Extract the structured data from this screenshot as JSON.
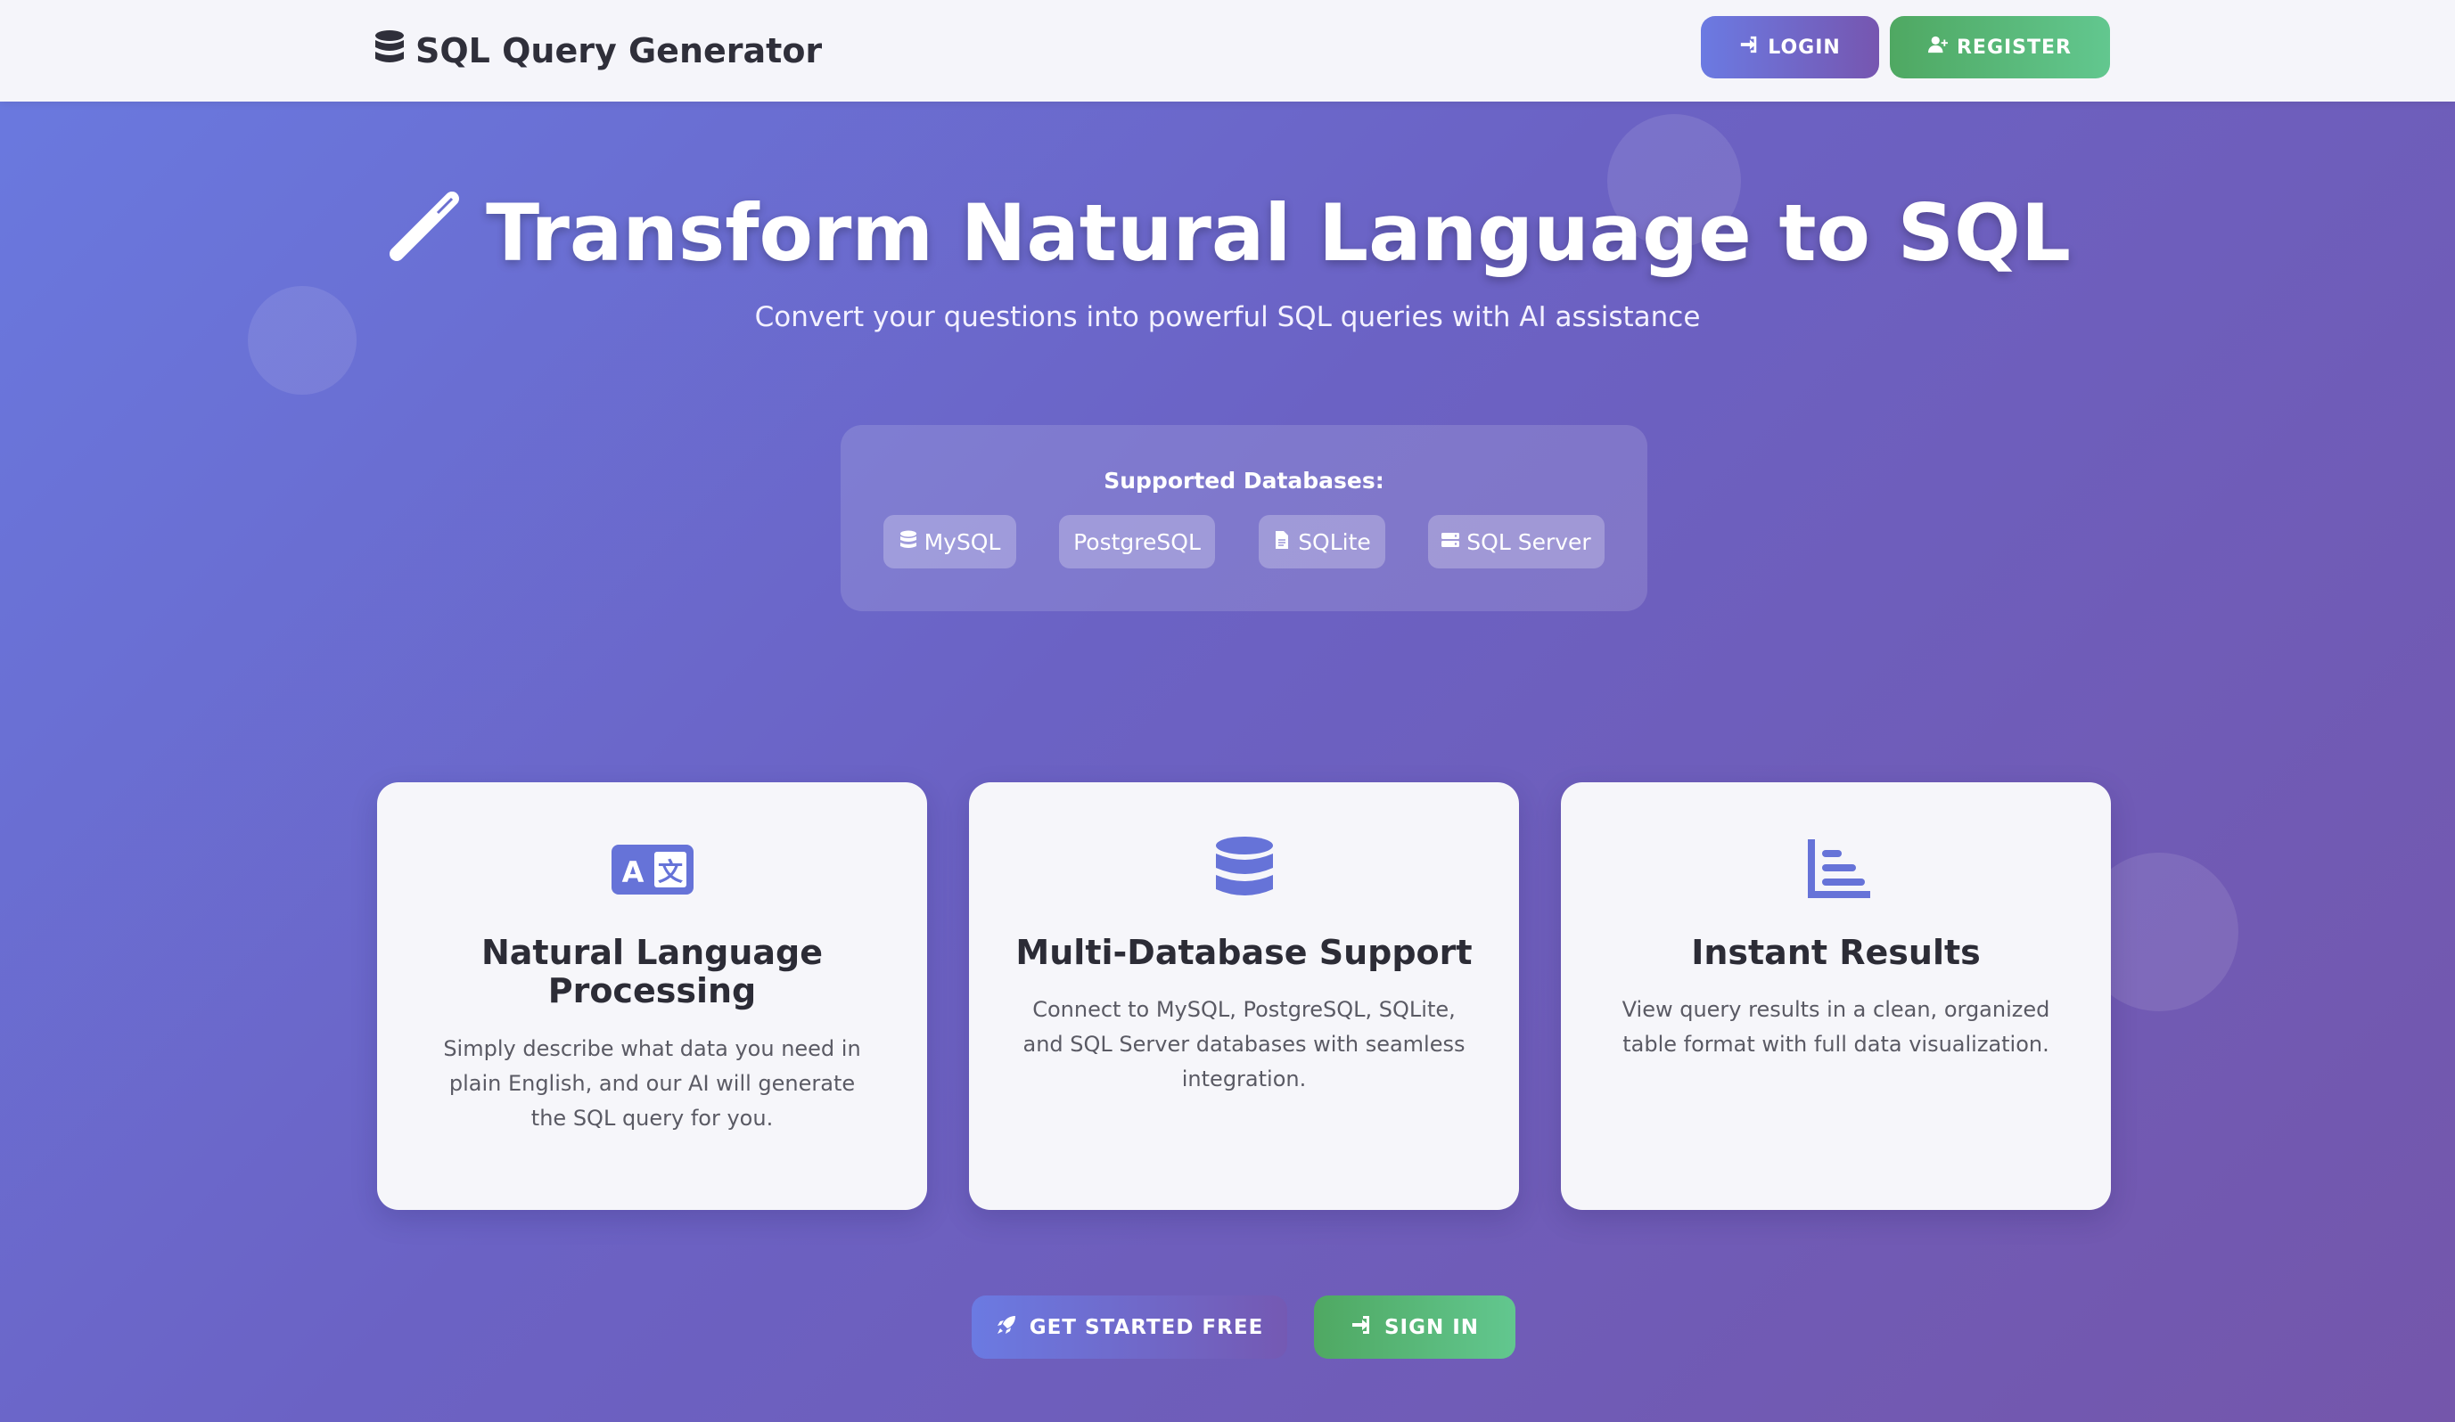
{
  "navbar": {
    "brand": "SQL Query Generator",
    "login_label": "LOGIN",
    "register_label": "REGISTER"
  },
  "hero": {
    "title": "Transform Natural Language to SQL",
    "subtitle": "Convert your questions into powerful SQL queries with AI assistance"
  },
  "databases": {
    "title": "Supported Databases:",
    "items": [
      {
        "label": "MySQL",
        "icon": "database-icon"
      },
      {
        "label": "PostgreSQL",
        "icon": ""
      },
      {
        "label": "SQLite",
        "icon": "file-icon"
      },
      {
        "label": "SQL Server",
        "icon": "server-icon"
      }
    ]
  },
  "features": [
    {
      "icon": "language-icon",
      "title": "Natural Language Processing",
      "description": "Simply describe what data you need in plain English, and our AI will generate the SQL query for you."
    },
    {
      "icon": "database-icon",
      "title": "Multi-Database Support",
      "description": "Connect to MySQL, PostgreSQL, SQLite, and SQL Server databases with seamless integration."
    },
    {
      "icon": "chart-bar-icon",
      "title": "Instant Results",
      "description": "View query results in a clean, organized table format with full data visualization."
    }
  ],
  "cta": {
    "get_started_label": "GET STARTED FREE",
    "sign_in_label": "SIGN IN"
  },
  "colors": {
    "accent_purple": "#6b7ae2",
    "accent_green": "#5cb878",
    "icon_color": "#6673d8"
  }
}
